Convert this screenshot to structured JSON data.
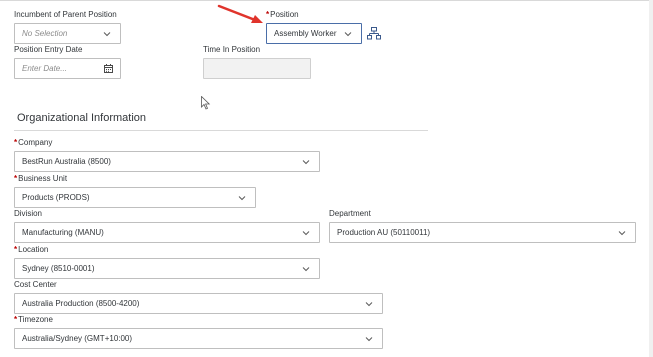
{
  "parent_position": {
    "label": "Incumbent of Parent Position",
    "placeholder": "No Selection",
    "icon": "chevron-down-icon"
  },
  "position": {
    "label": "Position",
    "required": true,
    "value": "Assembly Worker",
    "icon": "chevron-down-icon",
    "org_chart_icon": "org-chart-icon",
    "annotation_arrow_color": "#e0342c"
  },
  "position_entry_date": {
    "label": "Position Entry Date",
    "placeholder": "Enter Date...",
    "icon": "calendar-icon"
  },
  "time_in_position": {
    "label": "Time In Position",
    "value": ""
  },
  "org_info": {
    "title": "Organizational Information"
  },
  "company": {
    "label": "Company",
    "required": true,
    "value": "BestRun Australia (8500)"
  },
  "business_unit": {
    "label": "Business Unit",
    "required": true,
    "value": "Products (PRODS)"
  },
  "division": {
    "label": "Division",
    "required": false,
    "value": "Manufacturing (MANU)"
  },
  "department": {
    "label": "Department",
    "required": false,
    "value": "Production AU (50110011)"
  },
  "location": {
    "label": "Location",
    "required": true,
    "value": "Sydney (8510-0001)"
  },
  "cost_center": {
    "label": "Cost Center",
    "required": false,
    "value": "Australia Production (8500-4200)"
  },
  "timezone": {
    "label": "Timezone",
    "required": true,
    "value": "Australia/Sydney (GMT+10:00)"
  },
  "colors": {
    "required_asterisk": "#bb0000",
    "field_border": "#bfbfbf",
    "focus_border": "#4a6ea8",
    "icon_blue": "#3b5a8c"
  }
}
